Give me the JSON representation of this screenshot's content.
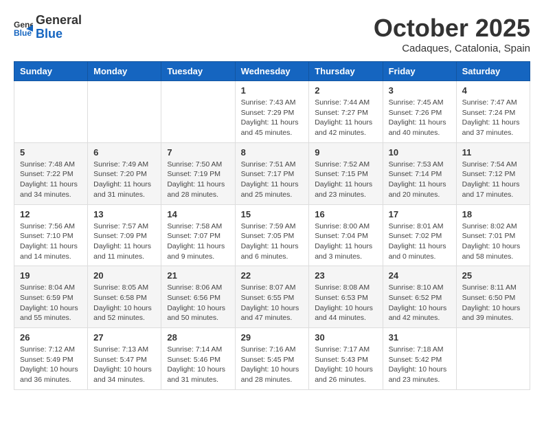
{
  "header": {
    "logo": {
      "line1": "General",
      "line2": "Blue"
    },
    "title": "October 2025",
    "location": "Cadaques, Catalonia, Spain"
  },
  "weekdays": [
    "Sunday",
    "Monday",
    "Tuesday",
    "Wednesday",
    "Thursday",
    "Friday",
    "Saturday"
  ],
  "weeks": [
    {
      "shaded": false,
      "days": [
        {
          "num": "",
          "info": ""
        },
        {
          "num": "",
          "info": ""
        },
        {
          "num": "",
          "info": ""
        },
        {
          "num": "1",
          "info": "Sunrise: 7:43 AM\nSunset: 7:29 PM\nDaylight: 11 hours\nand 45 minutes."
        },
        {
          "num": "2",
          "info": "Sunrise: 7:44 AM\nSunset: 7:27 PM\nDaylight: 11 hours\nand 42 minutes."
        },
        {
          "num": "3",
          "info": "Sunrise: 7:45 AM\nSunset: 7:26 PM\nDaylight: 11 hours\nand 40 minutes."
        },
        {
          "num": "4",
          "info": "Sunrise: 7:47 AM\nSunset: 7:24 PM\nDaylight: 11 hours\nand 37 minutes."
        }
      ]
    },
    {
      "shaded": true,
      "days": [
        {
          "num": "5",
          "info": "Sunrise: 7:48 AM\nSunset: 7:22 PM\nDaylight: 11 hours\nand 34 minutes."
        },
        {
          "num": "6",
          "info": "Sunrise: 7:49 AM\nSunset: 7:20 PM\nDaylight: 11 hours\nand 31 minutes."
        },
        {
          "num": "7",
          "info": "Sunrise: 7:50 AM\nSunset: 7:19 PM\nDaylight: 11 hours\nand 28 minutes."
        },
        {
          "num": "8",
          "info": "Sunrise: 7:51 AM\nSunset: 7:17 PM\nDaylight: 11 hours\nand 25 minutes."
        },
        {
          "num": "9",
          "info": "Sunrise: 7:52 AM\nSunset: 7:15 PM\nDaylight: 11 hours\nand 23 minutes."
        },
        {
          "num": "10",
          "info": "Sunrise: 7:53 AM\nSunset: 7:14 PM\nDaylight: 11 hours\nand 20 minutes."
        },
        {
          "num": "11",
          "info": "Sunrise: 7:54 AM\nSunset: 7:12 PM\nDaylight: 11 hours\nand 17 minutes."
        }
      ]
    },
    {
      "shaded": false,
      "days": [
        {
          "num": "12",
          "info": "Sunrise: 7:56 AM\nSunset: 7:10 PM\nDaylight: 11 hours\nand 14 minutes."
        },
        {
          "num": "13",
          "info": "Sunrise: 7:57 AM\nSunset: 7:09 PM\nDaylight: 11 hours\nand 11 minutes."
        },
        {
          "num": "14",
          "info": "Sunrise: 7:58 AM\nSunset: 7:07 PM\nDaylight: 11 hours\nand 9 minutes."
        },
        {
          "num": "15",
          "info": "Sunrise: 7:59 AM\nSunset: 7:05 PM\nDaylight: 11 hours\nand 6 minutes."
        },
        {
          "num": "16",
          "info": "Sunrise: 8:00 AM\nSunset: 7:04 PM\nDaylight: 11 hours\nand 3 minutes."
        },
        {
          "num": "17",
          "info": "Sunrise: 8:01 AM\nSunset: 7:02 PM\nDaylight: 11 hours\nand 0 minutes."
        },
        {
          "num": "18",
          "info": "Sunrise: 8:02 AM\nSunset: 7:01 PM\nDaylight: 10 hours\nand 58 minutes."
        }
      ]
    },
    {
      "shaded": true,
      "days": [
        {
          "num": "19",
          "info": "Sunrise: 8:04 AM\nSunset: 6:59 PM\nDaylight: 10 hours\nand 55 minutes."
        },
        {
          "num": "20",
          "info": "Sunrise: 8:05 AM\nSunset: 6:58 PM\nDaylight: 10 hours\nand 52 minutes."
        },
        {
          "num": "21",
          "info": "Sunrise: 8:06 AM\nSunset: 6:56 PM\nDaylight: 10 hours\nand 50 minutes."
        },
        {
          "num": "22",
          "info": "Sunrise: 8:07 AM\nSunset: 6:55 PM\nDaylight: 10 hours\nand 47 minutes."
        },
        {
          "num": "23",
          "info": "Sunrise: 8:08 AM\nSunset: 6:53 PM\nDaylight: 10 hours\nand 44 minutes."
        },
        {
          "num": "24",
          "info": "Sunrise: 8:10 AM\nSunset: 6:52 PM\nDaylight: 10 hours\nand 42 minutes."
        },
        {
          "num": "25",
          "info": "Sunrise: 8:11 AM\nSunset: 6:50 PM\nDaylight: 10 hours\nand 39 minutes."
        }
      ]
    },
    {
      "shaded": false,
      "days": [
        {
          "num": "26",
          "info": "Sunrise: 7:12 AM\nSunset: 5:49 PM\nDaylight: 10 hours\nand 36 minutes."
        },
        {
          "num": "27",
          "info": "Sunrise: 7:13 AM\nSunset: 5:47 PM\nDaylight: 10 hours\nand 34 minutes."
        },
        {
          "num": "28",
          "info": "Sunrise: 7:14 AM\nSunset: 5:46 PM\nDaylight: 10 hours\nand 31 minutes."
        },
        {
          "num": "29",
          "info": "Sunrise: 7:16 AM\nSunset: 5:45 PM\nDaylight: 10 hours\nand 28 minutes."
        },
        {
          "num": "30",
          "info": "Sunrise: 7:17 AM\nSunset: 5:43 PM\nDaylight: 10 hours\nand 26 minutes."
        },
        {
          "num": "31",
          "info": "Sunrise: 7:18 AM\nSunset: 5:42 PM\nDaylight: 10 hours\nand 23 minutes."
        },
        {
          "num": "",
          "info": ""
        }
      ]
    }
  ]
}
